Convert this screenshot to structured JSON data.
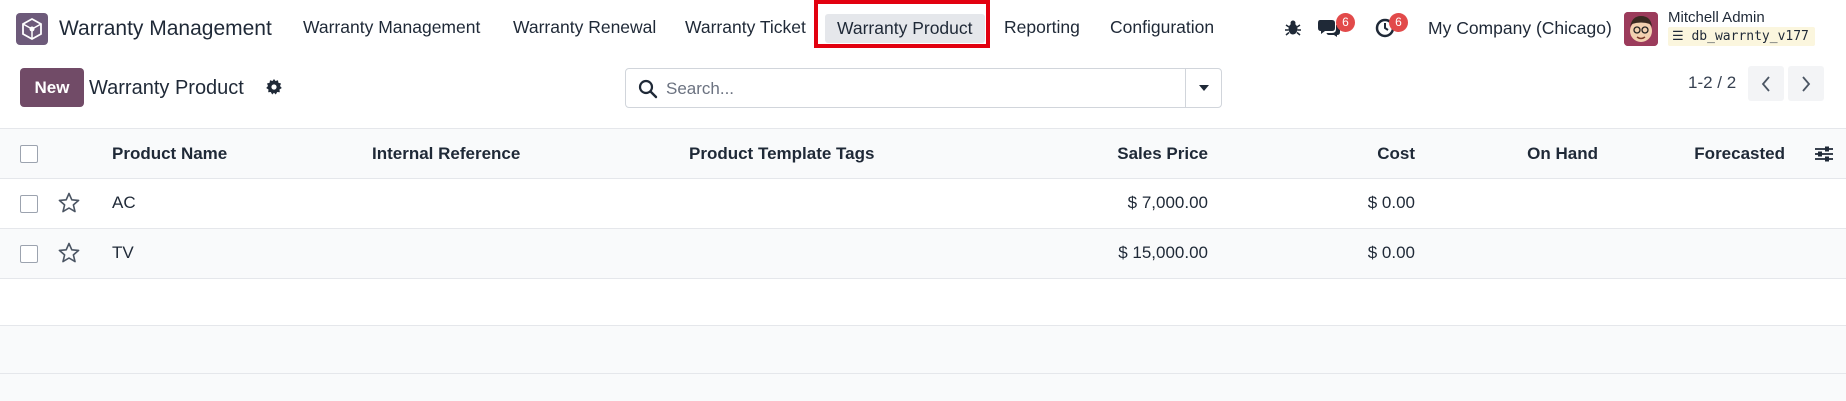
{
  "navbar": {
    "app_title": "Warranty Management",
    "menu": [
      {
        "label": "Warranty Management"
      },
      {
        "label": "Warranty Renewal"
      },
      {
        "label": "Warranty Ticket"
      },
      {
        "label": "Warranty Product",
        "active": true
      },
      {
        "label": "Reporting"
      },
      {
        "label": "Configuration"
      }
    ],
    "messages_badge": "6",
    "activities_badge": "6",
    "company": "My Company (Chicago)",
    "user_name": "Mitchell Admin",
    "database": "db_warrnty_v177",
    "highlight_color": "#e2000f"
  },
  "control_panel": {
    "new_label": "New",
    "title": "Warranty Product",
    "search_placeholder": "Search...",
    "pager": "1-2 / 2"
  },
  "table": {
    "columns": {
      "product_name": "Product Name",
      "internal_reference": "Internal Reference",
      "template_tags": "Product Template Tags",
      "sales_price": "Sales Price",
      "cost": "Cost",
      "on_hand": "On Hand",
      "forecasted": "Forecasted"
    },
    "rows": [
      {
        "name": "AC",
        "internal_reference": "",
        "tags": "",
        "sales_price": "$ 7,000.00",
        "cost": "$ 0.00",
        "on_hand": "",
        "forecasted": ""
      },
      {
        "name": "TV",
        "internal_reference": "",
        "tags": "",
        "sales_price": "$ 15,000.00",
        "cost": "$ 0.00",
        "on_hand": "",
        "forecasted": ""
      }
    ]
  },
  "colors": {
    "brand": "#714b67",
    "badge": "#e24a4a"
  }
}
